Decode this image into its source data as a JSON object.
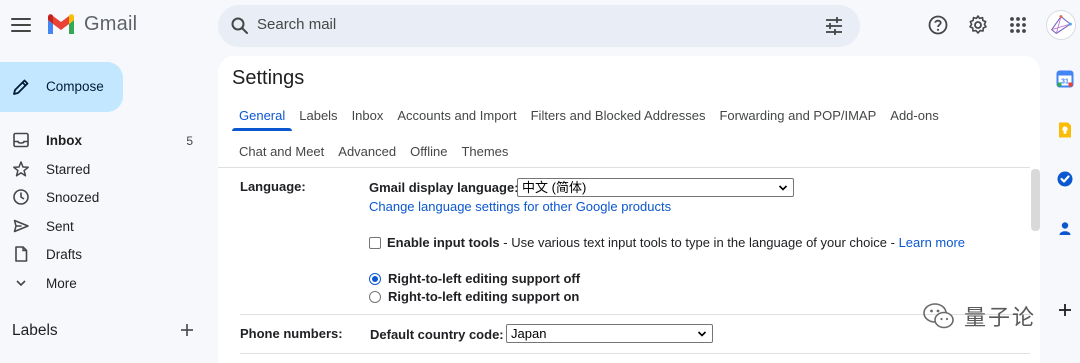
{
  "header": {
    "app_name": "Gmail",
    "search_placeholder": "Search mail"
  },
  "nav": {
    "compose_label": "Compose",
    "items": [
      {
        "label": "Inbox",
        "count": "5"
      },
      {
        "label": "Starred",
        "count": ""
      },
      {
        "label": "Snoozed",
        "count": ""
      },
      {
        "label": "Sent",
        "count": ""
      },
      {
        "label": "Drafts",
        "count": ""
      },
      {
        "label": "More",
        "count": ""
      }
    ],
    "labels_header": "Labels"
  },
  "settings": {
    "title": "Settings",
    "tabs_row1": [
      "General",
      "Labels",
      "Inbox",
      "Accounts and Import",
      "Filters and Blocked Addresses",
      "Forwarding and POP/IMAP",
      "Add-ons"
    ],
    "tabs_row2": [
      "Chat and Meet",
      "Advanced",
      "Offline",
      "Themes"
    ],
    "active_tab": "General",
    "language": {
      "row_label": "Language:",
      "display_label": "Gmail display language:",
      "display_value": "中文 (简体)",
      "change_link": "Change language settings for other Google products",
      "input_tools_label": "Enable input tools",
      "input_tools_desc": " - Use various text input tools to type in the language of your choice - ",
      "learn_more": "Learn more",
      "input_tools_checked": false,
      "rtl_off_label": "Right-to-left editing support off",
      "rtl_on_label": "Right-to-left editing support on",
      "rtl_selected": "off"
    },
    "phone": {
      "row_label": "Phone numbers:",
      "country_label": "Default country code:",
      "country_value": "Japan"
    }
  },
  "watermark": {
    "text": "量子论"
  },
  "colors": {
    "accent": "#0b57d0",
    "compose_bg": "#c2e7ff",
    "page_bg": "#f6f8fc"
  }
}
